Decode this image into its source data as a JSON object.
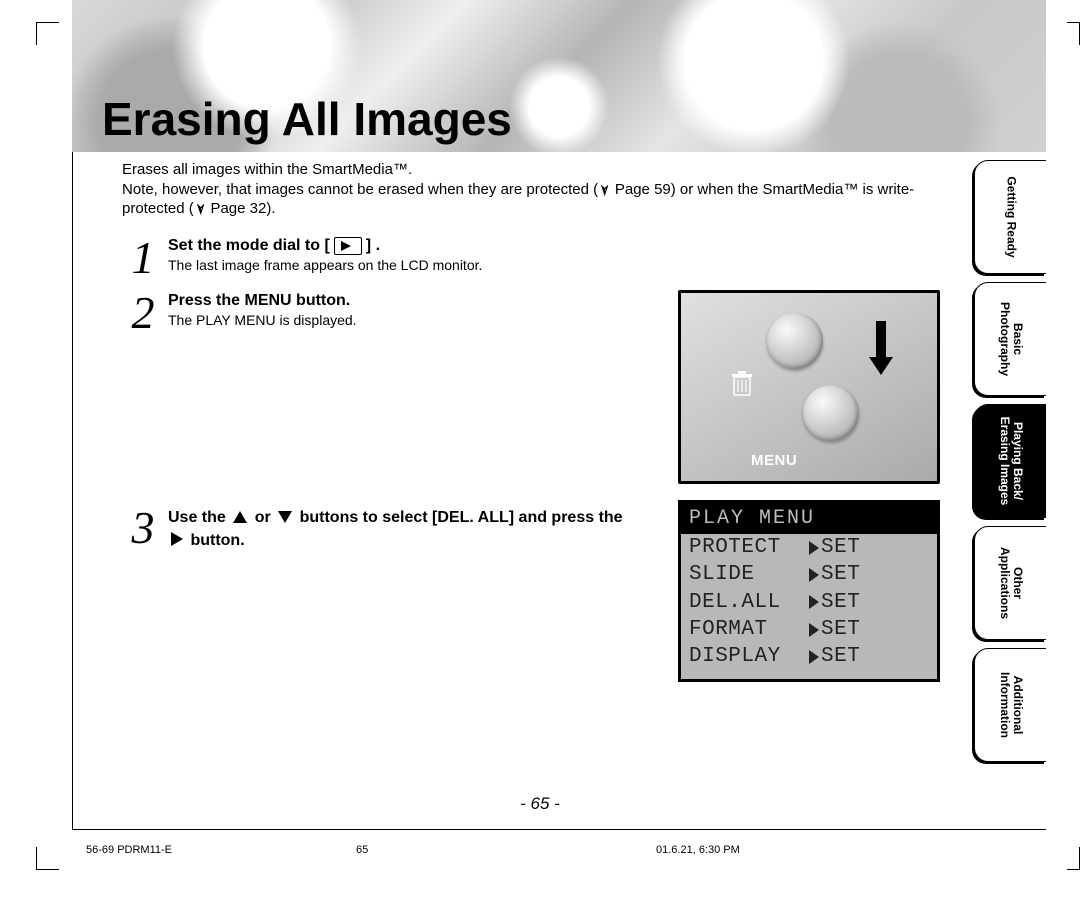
{
  "page": {
    "title": "Erasing All Images",
    "intro_1": "Erases all images within the SmartMedia™.",
    "intro_2a": "Note, however, that images cannot be erased when they are protected (",
    "intro_2b": " Page 59) or when the SmartMedia™ is write-protected (",
    "intro_2c": " Page 32).",
    "page_number": "- 65 -"
  },
  "steps": [
    {
      "num": "1",
      "head_before": "Set the mode dial to  [",
      "head_after": "] .",
      "sub": "The last image frame appears on the LCD monitor."
    },
    {
      "num": "2",
      "head_before": "Press the MENU button.",
      "head_after": "",
      "sub": "The PLAY MENU is displayed."
    },
    {
      "num": "3",
      "head_before": "Use the ",
      "head_mid": " or ",
      "head_mid2": " buttons to select [DEL. ALL] and press the ",
      "head_after": " button.",
      "sub": ""
    }
  ],
  "photo": {
    "menu_label": "MENU"
  },
  "lcd": {
    "header": "PLAY MENU",
    "rows": [
      {
        "key": "PROTECT",
        "val": "SET"
      },
      {
        "key": "SLIDE",
        "val": "SET"
      },
      {
        "key": "DEL.ALL",
        "val": "SET"
      },
      {
        "key": "FORMAT",
        "val": "SET"
      },
      {
        "key": "DISPLAY",
        "val": "SET"
      }
    ]
  },
  "tabs": [
    {
      "label": "Getting Ready",
      "active": false
    },
    {
      "label": "Basic\nPhotography",
      "active": false
    },
    {
      "label": "Playing Back/\nErasing Images",
      "active": true
    },
    {
      "label": "Other\nApplications",
      "active": false
    },
    {
      "label": "Additional\nInformation",
      "active": false
    }
  ],
  "footer": {
    "file": "56-69 PDRM11-E",
    "page": "65",
    "timestamp": "01.6.21, 6:30 PM"
  }
}
